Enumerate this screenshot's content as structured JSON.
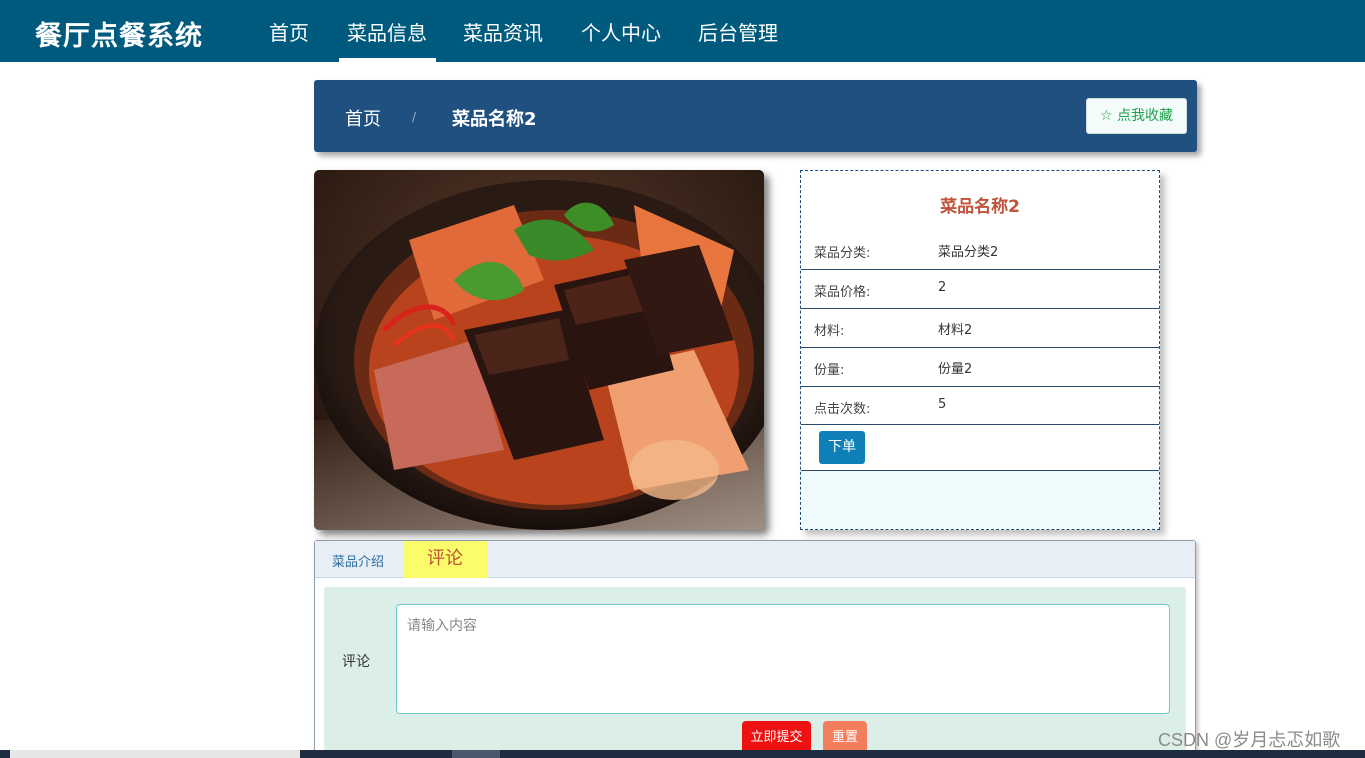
{
  "nav": {
    "brand": "餐厅点餐系统",
    "items": [
      {
        "label": "首页"
      },
      {
        "label": "菜品信息"
      },
      {
        "label": "菜品资讯"
      },
      {
        "label": "个人中心"
      },
      {
        "label": "后台管理"
      }
    ],
    "active_item": "菜品信息"
  },
  "breadcrumb": {
    "home": "首页",
    "separator": "/",
    "current": "菜品名称2"
  },
  "favorite_button": {
    "icon": "star-outline-icon",
    "label": "☆ 点我收藏"
  },
  "detail": {
    "title": "菜品名称2",
    "rows": [
      {
        "label": "菜品分类:",
        "value": "菜品分类2"
      },
      {
        "label": "菜品价格:",
        "value": "2"
      },
      {
        "label": "材料:",
        "value": "材料2"
      },
      {
        "label": "份量:",
        "value": "份量2"
      },
      {
        "label": "点击次数:",
        "value": "5"
      }
    ],
    "order_button": "下单"
  },
  "tabs": {
    "items": [
      {
        "label": "菜品介绍"
      },
      {
        "label": "评论"
      }
    ],
    "active": "评论"
  },
  "comment_form": {
    "label": "评论",
    "placeholder": "请输入内容",
    "value": "",
    "submit_label": "立即提交",
    "reset_label": "重置"
  },
  "watermark": "CSDN @岁月忐忑如歌",
  "colors": {
    "nav_bg": "#005a7d",
    "crumb_bg": "#1f5080",
    "title_accent": "#c0533a",
    "order_button": "#0f7fb8",
    "submit_button": "#ee1111",
    "reset_button": "#f47d5c",
    "active_tab": "#fafc6a"
  }
}
